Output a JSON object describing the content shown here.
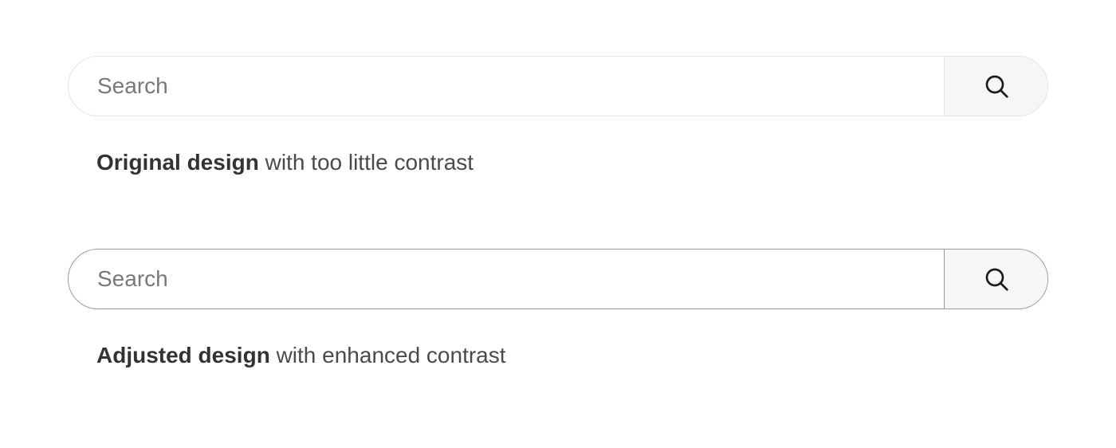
{
  "examples": {
    "original": {
      "placeholder": "Search",
      "caption_bold": "Original design",
      "caption_rest": " with too little contrast"
    },
    "adjusted": {
      "placeholder": "Search",
      "caption_bold": "Adjusted design",
      "caption_rest": " with enhanced contrast"
    }
  }
}
